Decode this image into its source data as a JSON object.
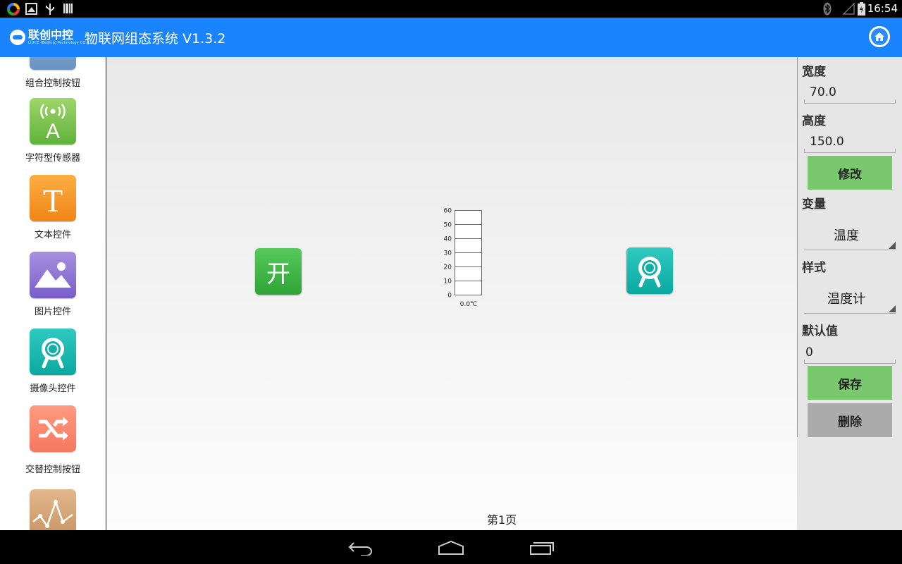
{
  "status_bar": {
    "time": "16:54",
    "left_icons": [
      "colorful-circle-icon",
      "image-icon",
      "usb-icon",
      "barcode-icon"
    ],
    "right_icons": [
      "bluetooth-icon",
      "signal-icon",
      "battery-icon"
    ]
  },
  "app_bar": {
    "logo_text": "联创中控",
    "logo_subtext": "LIUCE (BeiJing) Technology CO.,Ltd",
    "title": "物联网组态系统 V1.3.2",
    "home_icon": "home-icon",
    "color": "#1a84ff"
  },
  "palette": {
    "items": [
      {
        "label": "组合控制按钮",
        "icon": "combo-control-icon"
      },
      {
        "label": "字符型传感器",
        "icon": "text-sensor-icon"
      },
      {
        "label": "文本控件",
        "icon": "text-widget-icon"
      },
      {
        "label": "图片控件",
        "icon": "image-widget-icon"
      },
      {
        "label": "摄像头控件",
        "icon": "camera-widget-icon"
      },
      {
        "label": "交替控制按钮",
        "icon": "toggle-control-icon"
      },
      {
        "label": "",
        "icon": "chart-widget-icon"
      }
    ]
  },
  "canvas": {
    "switch_label": "开",
    "thermometer": {
      "ticks": [
        "60",
        "50",
        "40",
        "30",
        "20",
        "10",
        "0"
      ],
      "reading": "0.0℃",
      "value": 0
    },
    "page_label": "第1页"
  },
  "properties": {
    "width_label": "宽度",
    "width_value": "70.0",
    "height_label": "高度",
    "height_value": "150.0",
    "modify_button": "修改",
    "variable_label": "变量",
    "variable_value": "温度",
    "style_label": "样式",
    "style_value": "温度计",
    "default_label": "默认值",
    "default_value": "0",
    "save_button": "保存",
    "delete_button": "删除"
  },
  "nav_bar": {
    "icons": [
      "back-icon",
      "home-nav-icon",
      "recent-apps-icon"
    ]
  }
}
